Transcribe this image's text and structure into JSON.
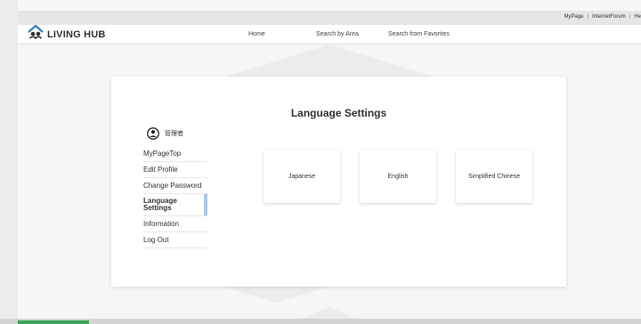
{
  "topbar": {
    "links": [
      "MyPage",
      "InternetForum",
      "He"
    ],
    "separator": "|"
  },
  "header": {
    "logo_text": "LIVING HUB",
    "nav": [
      "Home",
      "Search by Area",
      "Search from Favorites"
    ]
  },
  "main": {
    "title": "Language Settings",
    "user_name": "管理者",
    "sidebar": [
      {
        "label": "MyPageTop",
        "active": false
      },
      {
        "label": "Edit Profile",
        "active": false
      },
      {
        "label": "Change Password",
        "active": false
      },
      {
        "label": "Language Settings",
        "active": true
      },
      {
        "label": "Information",
        "active": false
      },
      {
        "label": "Log Out",
        "active": false
      }
    ],
    "languages": [
      "Japanese",
      "English",
      "Simplified Chinese"
    ]
  },
  "colors": {
    "active_indicator": "#a9c8ea",
    "logo_blue": "#2f7fbf",
    "bottom_accent": "#3aa65a"
  }
}
